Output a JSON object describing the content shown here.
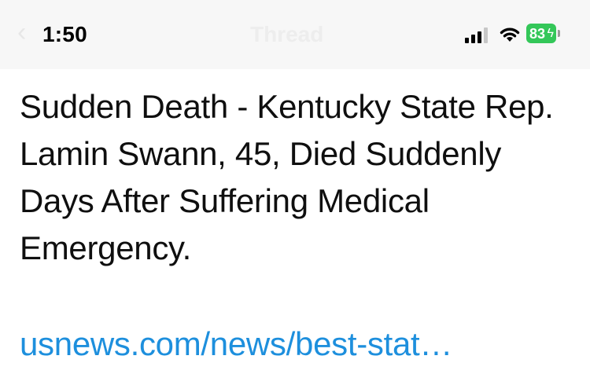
{
  "status_bar": {
    "time": "1:50",
    "nav_title": "Thread",
    "battery_level": "83",
    "back_icon": "chevron-left-icon",
    "signal_icon": "cellular-signal-icon",
    "wifi_icon": "wifi-icon",
    "battery_icon": "battery-charging-icon",
    "battery_color": "#34c759"
  },
  "tweet": {
    "text": "Sudden Death - Kentucky State Rep. Lamin Swann, 45, Died Suddenly Days After Suffering Medical Emergency.",
    "link_text": "usnews.com/news/best-stat…",
    "link_color": "#1d8fdd"
  }
}
